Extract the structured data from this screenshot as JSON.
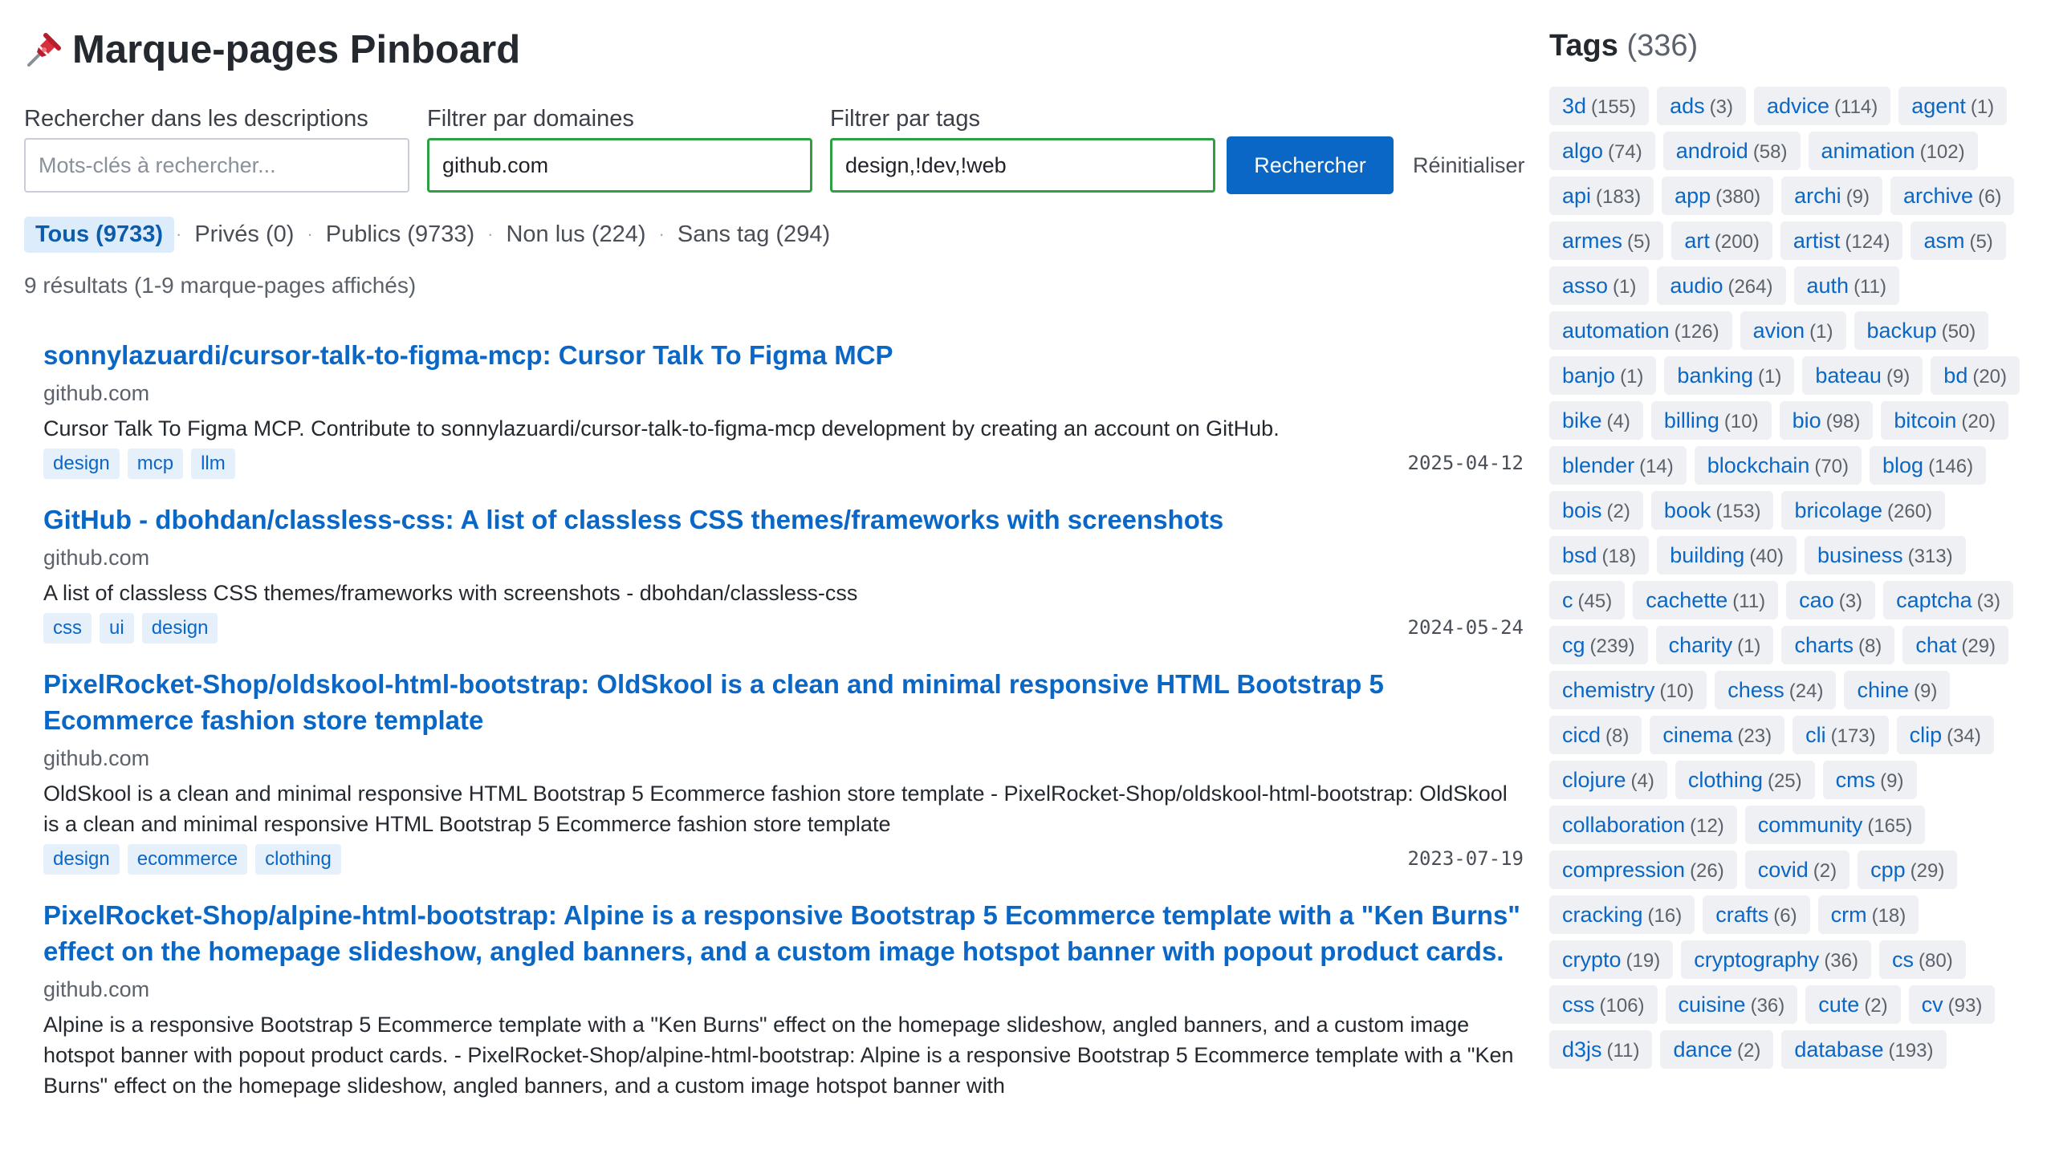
{
  "app": {
    "title": "Marque-pages Pinboard"
  },
  "search": {
    "desc_label": "Rechercher dans les descriptions",
    "desc_placeholder": "Mots-clés à rechercher...",
    "desc_value": "",
    "domain_label": "Filtrer par domaines",
    "domain_value": "github.com",
    "tags_label": "Filtrer par tags",
    "tags_value": "design,!dev,!web",
    "submit_label": "Rechercher",
    "reset_label": "Réinitialiser"
  },
  "filters": [
    {
      "label": "Tous (9733)",
      "active": true
    },
    {
      "label": "Privés (0)",
      "active": false
    },
    {
      "label": "Publics (9733)",
      "active": false
    },
    {
      "label": "Non lus (224)",
      "active": false
    },
    {
      "label": "Sans tag (294)",
      "active": false
    }
  ],
  "summary": "9 résultats (1-9 marque-pages affichés)",
  "bookmarks": [
    {
      "title": "sonnylazuardi/cursor-talk-to-figma-mcp: Cursor Talk To Figma MCP",
      "domain": "github.com",
      "description": "Cursor Talk To Figma MCP. Contribute to sonnylazuardi/cursor-talk-to-figma-mcp development by creating an account on GitHub.",
      "tags": [
        "design",
        "mcp",
        "llm"
      ],
      "date": "2025-04-12"
    },
    {
      "title": "GitHub - dbohdan/classless-css: A list of classless CSS themes/frameworks with screenshots",
      "domain": "github.com",
      "description": "A list of classless CSS themes/frameworks with screenshots - dbohdan/classless-css",
      "tags": [
        "css",
        "ui",
        "design"
      ],
      "date": "2024-05-24"
    },
    {
      "title": "PixelRocket-Shop/oldskool-html-bootstrap: OldSkool is a clean and minimal responsive HTML Bootstrap 5 Ecommerce fashion store template",
      "domain": "github.com",
      "description": "OldSkool is a clean and minimal responsive HTML Bootstrap 5 Ecommerce fashion store template - PixelRocket-Shop/oldskool-html-bootstrap: OldSkool is a clean and minimal responsive HTML Bootstrap 5 Ecommerce fashion store template",
      "tags": [
        "design",
        "ecommerce",
        "clothing"
      ],
      "date": "2023-07-19"
    },
    {
      "title": "PixelRocket-Shop/alpine-html-bootstrap: Alpine is a responsive Bootstrap 5 Ecommerce template with a \"Ken Burns\" effect on the homepage slideshow, angled banners, and a custom image hotspot banner with popout product cards.",
      "domain": "github.com",
      "description": "Alpine is a responsive Bootstrap 5 Ecommerce template with a \"Ken Burns\" effect on the homepage slideshow, angled banners, and a custom image hotspot banner with popout product cards. - PixelRocket-Shop/alpine-html-bootstrap: Alpine is a responsive Bootstrap 5 Ecommerce template with a \"Ken Burns\" effect on the homepage slideshow, angled banners, and a custom image hotspot banner with",
      "tags": [],
      "date": ""
    }
  ],
  "tags_panel": {
    "title": "Tags",
    "count": "(336)",
    "tags": [
      {
        "name": "3d",
        "count": "(155)"
      },
      {
        "name": "ads",
        "count": "(3)"
      },
      {
        "name": "advice",
        "count": "(114)"
      },
      {
        "name": "agent",
        "count": "(1)"
      },
      {
        "name": "algo",
        "count": "(74)"
      },
      {
        "name": "android",
        "count": "(58)"
      },
      {
        "name": "animation",
        "count": "(102)"
      },
      {
        "name": "api",
        "count": "(183)"
      },
      {
        "name": "app",
        "count": "(380)"
      },
      {
        "name": "archi",
        "count": "(9)"
      },
      {
        "name": "archive",
        "count": "(6)"
      },
      {
        "name": "armes",
        "count": "(5)"
      },
      {
        "name": "art",
        "count": "(200)"
      },
      {
        "name": "artist",
        "count": "(124)"
      },
      {
        "name": "asm",
        "count": "(5)"
      },
      {
        "name": "asso",
        "count": "(1)"
      },
      {
        "name": "audio",
        "count": "(264)"
      },
      {
        "name": "auth",
        "count": "(11)"
      },
      {
        "name": "automation",
        "count": "(126)"
      },
      {
        "name": "avion",
        "count": "(1)"
      },
      {
        "name": "backup",
        "count": "(50)"
      },
      {
        "name": "banjo",
        "count": "(1)"
      },
      {
        "name": "banking",
        "count": "(1)"
      },
      {
        "name": "bateau",
        "count": "(9)"
      },
      {
        "name": "bd",
        "count": "(20)"
      },
      {
        "name": "bike",
        "count": "(4)"
      },
      {
        "name": "billing",
        "count": "(10)"
      },
      {
        "name": "bio",
        "count": "(98)"
      },
      {
        "name": "bitcoin",
        "count": "(20)"
      },
      {
        "name": "blender",
        "count": "(14)"
      },
      {
        "name": "blockchain",
        "count": "(70)"
      },
      {
        "name": "blog",
        "count": "(146)"
      },
      {
        "name": "bois",
        "count": "(2)"
      },
      {
        "name": "book",
        "count": "(153)"
      },
      {
        "name": "bricolage",
        "count": "(260)"
      },
      {
        "name": "bsd",
        "count": "(18)"
      },
      {
        "name": "building",
        "count": "(40)"
      },
      {
        "name": "business",
        "count": "(313)"
      },
      {
        "name": "c",
        "count": "(45)"
      },
      {
        "name": "cachette",
        "count": "(11)"
      },
      {
        "name": "cao",
        "count": "(3)"
      },
      {
        "name": "captcha",
        "count": "(3)"
      },
      {
        "name": "cg",
        "count": "(239)"
      },
      {
        "name": "charity",
        "count": "(1)"
      },
      {
        "name": "charts",
        "count": "(8)"
      },
      {
        "name": "chat",
        "count": "(29)"
      },
      {
        "name": "chemistry",
        "count": "(10)"
      },
      {
        "name": "chess",
        "count": "(24)"
      },
      {
        "name": "chine",
        "count": "(9)"
      },
      {
        "name": "cicd",
        "count": "(8)"
      },
      {
        "name": "cinema",
        "count": "(23)"
      },
      {
        "name": "cli",
        "count": "(173)"
      },
      {
        "name": "clip",
        "count": "(34)"
      },
      {
        "name": "clojure",
        "count": "(4)"
      },
      {
        "name": "clothing",
        "count": "(25)"
      },
      {
        "name": "cms",
        "count": "(9)"
      },
      {
        "name": "collaboration",
        "count": "(12)"
      },
      {
        "name": "community",
        "count": "(165)"
      },
      {
        "name": "compression",
        "count": "(26)"
      },
      {
        "name": "covid",
        "count": "(2)"
      },
      {
        "name": "cpp",
        "count": "(29)"
      },
      {
        "name": "cracking",
        "count": "(16)"
      },
      {
        "name": "crafts",
        "count": "(6)"
      },
      {
        "name": "crm",
        "count": "(18)"
      },
      {
        "name": "crypto",
        "count": "(19)"
      },
      {
        "name": "cryptography",
        "count": "(36)"
      },
      {
        "name": "cs",
        "count": "(80)"
      },
      {
        "name": "css",
        "count": "(106)"
      },
      {
        "name": "cuisine",
        "count": "(36)"
      },
      {
        "name": "cute",
        "count": "(2)"
      },
      {
        "name": "cv",
        "count": "(93)"
      },
      {
        "name": "d3js",
        "count": "(11)"
      },
      {
        "name": "dance",
        "count": "(2)"
      },
      {
        "name": "database",
        "count": "(193)"
      }
    ]
  },
  "colors": {
    "accent": "#0b67c6",
    "active_border": "#2ea043",
    "tag_bg": "#e6f0fb",
    "cloud_bg": "#eef0f3"
  },
  "icons": {
    "title_icon": "pushpin-icon"
  }
}
